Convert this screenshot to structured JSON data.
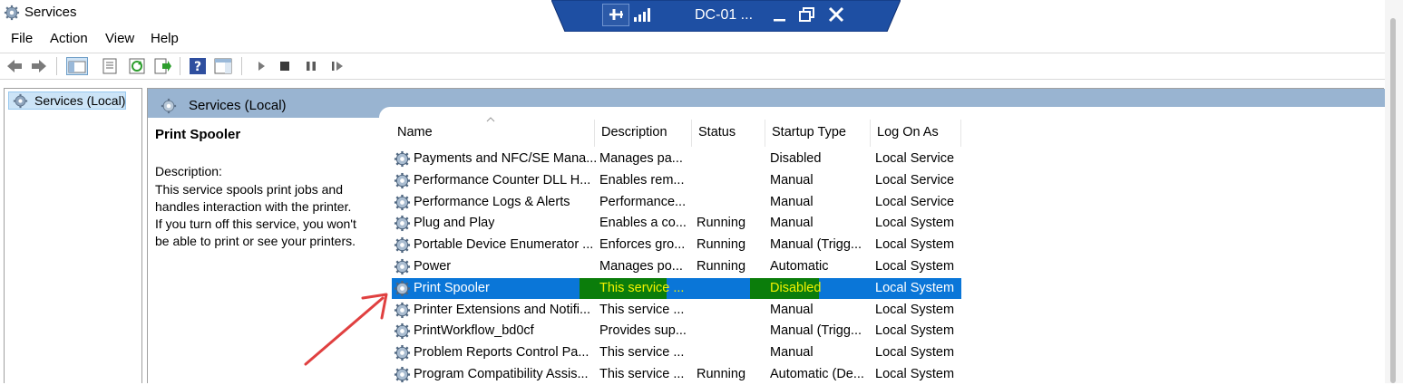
{
  "window": {
    "title": "Services"
  },
  "remote_bar": {
    "title": "DC-01 ..."
  },
  "menu": {
    "items": [
      "File",
      "Action",
      "View",
      "Help"
    ]
  },
  "tree": {
    "item": "Services (Local)"
  },
  "header": {
    "title": "Services (Local)"
  },
  "details": {
    "service_name": "Print Spooler",
    "description_label": "Description:",
    "description_lines": [
      "This service spools print jobs and",
      "handles interaction with the printer.",
      "If you turn off this service, you won't",
      "be able to print or see your printers."
    ]
  },
  "columns": [
    "Name",
    "Description",
    "Status",
    "Startup Type",
    "Log On As"
  ],
  "rows": [
    {
      "name": "Payments and NFC/SE Mana...",
      "description": "Manages pa...",
      "status": "",
      "startup": "Disabled",
      "logon": "Local Service"
    },
    {
      "name": "Performance Counter DLL H...",
      "description": "Enables rem...",
      "status": "",
      "startup": "Manual",
      "logon": "Local Service"
    },
    {
      "name": "Performance Logs & Alerts",
      "description": "Performance...",
      "status": "",
      "startup": "Manual",
      "logon": "Local Service"
    },
    {
      "name": "Plug and Play",
      "description": "Enables a co...",
      "status": "Running",
      "startup": "Manual",
      "logon": "Local System"
    },
    {
      "name": "Portable Device Enumerator ...",
      "description": "Enforces gro...",
      "status": "Running",
      "startup": "Manual (Trigg...",
      "logon": "Local System"
    },
    {
      "name": "Power",
      "description": "Manages po...",
      "status": "Running",
      "startup": "Automatic",
      "logon": "Local System"
    },
    {
      "name": "Print Spooler",
      "description": "This service ...",
      "status": "",
      "startup": "Disabled",
      "logon": "Local System",
      "selected": true
    },
    {
      "name": "Printer Extensions and Notifi...",
      "description": "This service ...",
      "status": "",
      "startup": "Manual",
      "logon": "Local System"
    },
    {
      "name": "PrintWorkflow_bd0cf",
      "description": "Provides sup...",
      "status": "",
      "startup": "Manual (Trigg...",
      "logon": "Local System"
    },
    {
      "name": "Problem Reports Control Pa...",
      "description": "This service ...",
      "status": "",
      "startup": "Manual",
      "logon": "Local System"
    },
    {
      "name": "Program Compatibility Assis...",
      "description": "This service ...",
      "status": "Running",
      "startup": "Automatic (De...",
      "logon": "Local System"
    }
  ],
  "colors": {
    "selection": "#0a76d8",
    "highlight_green": "#0b7d0b",
    "highlight_text": "#f2f200",
    "header_band": "#99b4d1",
    "remote_bar": "#1e4fa3",
    "annotation_arrow": "#e04040"
  }
}
